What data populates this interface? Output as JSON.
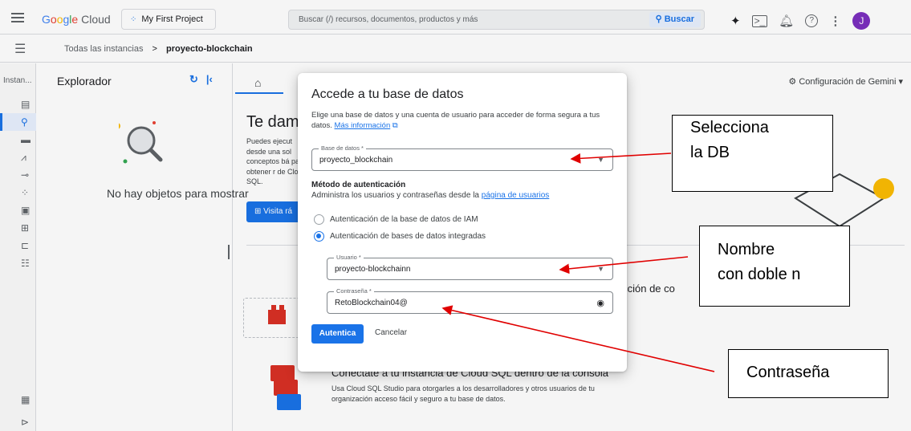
{
  "topbar": {
    "logo_google": "Google",
    "logo_cloud": " Cloud",
    "project": "My First Project",
    "search_placeholder": "Buscar (/) recursos, documentos, productos y más",
    "search_button": "Buscar",
    "avatar_letter": "J"
  },
  "breadcrumb": {
    "parent": "Todas las instancias",
    "separator": ">",
    "current": "proyecto-blockchain"
  },
  "rail": {
    "title": "Instan..."
  },
  "explorer": {
    "title": "Explorador",
    "empty_text": "No hay objetos para mostrar"
  },
  "main": {
    "gemini_label": "Configuración de Gemini",
    "welcome_title": "Te damo",
    "welcome_body": "Puedes ejecut desde una sol conceptos bá para obtener r de Cloud SQL.",
    "visit_button": "Visita rá",
    "card1_text": "dicción de co",
    "card2_title": "Conéctate a tu instancia de Cloud SQL dentro de la consola",
    "card2_body": "Usa Cloud SQL Studio para otorgarles a los desarrolladores y otros usuarios de tu organización acceso fácil y seguro a tu base de datos."
  },
  "dialog": {
    "title": "Accede a tu base de datos",
    "description": "Elige una base de datos y una cuenta de usuario para acceder de forma segura a tus datos.",
    "more_info": "Más información",
    "database_label": "Base de datos *",
    "database_value": "proyecto_blockchain",
    "auth_title": "Método de autenticación",
    "auth_subtitle": "Administra los usuarios y contraseñas desde la",
    "users_page_link": "página de usuarios",
    "radio_iam": "Autenticación de la base de datos de IAM",
    "radio_builtin": "Autenticación de bases de datos integradas",
    "selected_auth": "Autenticación de bases de datos integradas",
    "user_label": "Usuario *",
    "user_value": "proyecto-blockchainn",
    "password_label": "Contraseña *",
    "password_value": "RetoBlockchain04@",
    "authenticate_button": "Autentica",
    "cancel_button": "Cancelar"
  },
  "annotations": {
    "db_line1": "Selecciona",
    "db_line2": "la DB",
    "user_line1": "Nombre",
    "user_line2": "con doble n",
    "password": "Contraseña"
  },
  "colors": {
    "accent": "#1a73e8",
    "arrow": "#e00000",
    "avatar": "#7b2fbf"
  }
}
